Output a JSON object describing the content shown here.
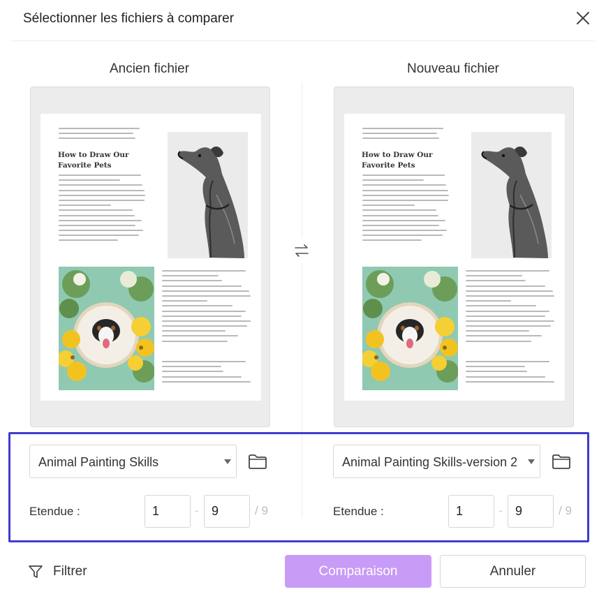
{
  "dialog": {
    "title": "Sélectionner les fichiers à comparer",
    "close_icon": "close-icon",
    "swap_icon": "swap-arrows-icon"
  },
  "left": {
    "title": "Ancien fichier",
    "file_name": "Animal Painting Skills",
    "folder_icon": "folder-icon",
    "range_label": "Etendue :",
    "range_from": "1",
    "range_dash": "-",
    "range_to": "9",
    "total_pages": "/ 9",
    "preview": {
      "heading_line1": "How to Draw Our",
      "heading_line2": "Favorite Pets"
    }
  },
  "right": {
    "title": "Nouveau fichier",
    "file_name": "Animal Painting Skills-version 2",
    "folder_icon": "folder-icon",
    "range_label": "Etendue :",
    "range_from": "1",
    "range_dash": "-",
    "range_to": "9",
    "total_pages": "/ 9",
    "preview": {
      "heading_line1": "How to Draw Our",
      "heading_line2": "Favorite Pets"
    }
  },
  "footer": {
    "filter_label": "Filtrer",
    "filter_icon": "filter-funnel-icon",
    "compare_label": "Comparaison",
    "cancel_label": "Annuler"
  },
  "colors": {
    "primary_button": "#c89bf6",
    "highlight_frame": "#3f3bd0"
  }
}
